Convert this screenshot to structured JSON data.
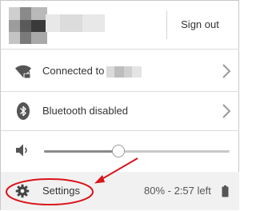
{
  "header": {
    "signout_label": "Sign out"
  },
  "rows": {
    "network": {
      "label": "Connected to",
      "icon": "wifi-locked-icon"
    },
    "bluetooth": {
      "label": "Bluetooth disabled",
      "icon": "bluetooth-icon"
    }
  },
  "volume": {
    "icon": "speaker-icon",
    "level": 0.4
  },
  "footer": {
    "settings_label": "Settings",
    "settings_icon": "gear-icon",
    "battery_status": "80% - 2:57 left",
    "battery_icon": "battery-icon"
  },
  "colors": {
    "annotation": "#d9141b",
    "footer_bg": "#f1f1f1",
    "icon": "#555555"
  }
}
